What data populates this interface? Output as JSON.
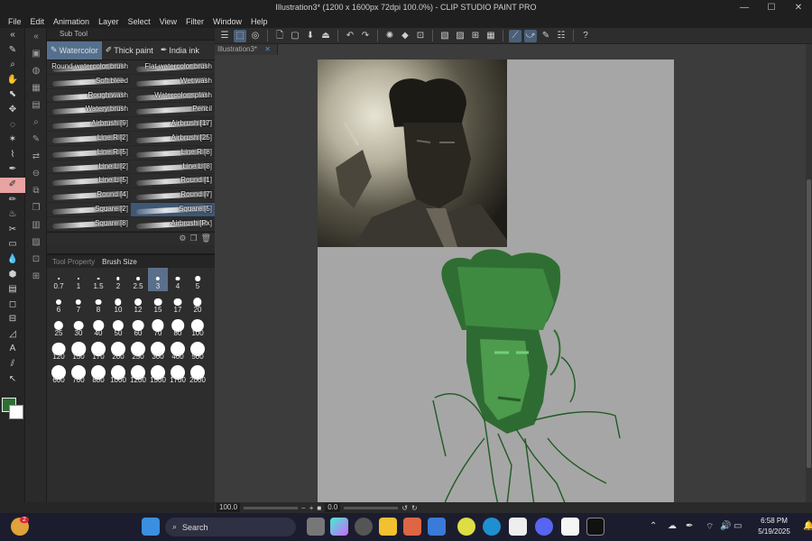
{
  "window": {
    "title": "Illustration3* (1200 x 1600px 72dpi 100.0%) - CLIP STUDIO PAINT PRO",
    "minimize": "—",
    "maximize": "☐",
    "close": "✕"
  },
  "menu": [
    "File",
    "Edit",
    "Animation",
    "Layer",
    "Select",
    "View",
    "Filter",
    "Window",
    "Help"
  ],
  "doc_tab": {
    "label": "Illustration3*",
    "close": "✕"
  },
  "sub_tool_panel": {
    "title": "Sub Tool",
    "tabs": [
      {
        "label": "Watercolor",
        "active": true
      },
      {
        "label": "Thick paint",
        "active": false
      },
      {
        "label": "India ink",
        "active": false
      }
    ],
    "brushes": [
      "Round watercolor brush",
      "Flat watercolor brush",
      "Soft bleed",
      "Wet wash",
      "Rough wash",
      "Watercolor splash",
      "Watery brush",
      "Pencil",
      "Airbrush [9]",
      "Airbrush [17]",
      "Line R [2]",
      "Airbrush [25]",
      "Line R [5]",
      "Line R [8]",
      "Line L [2]",
      "Line L [8]",
      "Line L [5]",
      "Round [1]",
      "Round [4]",
      "Round [7]",
      "Square [2]",
      "Square [5]",
      "Square [8]",
      "Airbrush [Px]"
    ],
    "selected_brush": "Square [5]"
  },
  "brush_size_panel": {
    "tabs": [
      {
        "label": "Tool Property",
        "active": false
      },
      {
        "label": "Brush Size",
        "active": true
      }
    ],
    "sizes": [
      "0.7",
      "1",
      "1.5",
      "2",
      "2.5",
      "3",
      "4",
      "5",
      "6",
      "7",
      "8",
      "10",
      "12",
      "15",
      "17",
      "20",
      "25",
      "30",
      "40",
      "50",
      "60",
      "70",
      "80",
      "100",
      "120",
      "150",
      "170",
      "200",
      "250",
      "300",
      "400",
      "500",
      "600",
      "700",
      "800",
      "1000",
      "1200",
      "1500",
      "1700",
      "2000"
    ],
    "selected": "3"
  },
  "colors": {
    "main": "#2f6e32",
    "sub": "#ffffff",
    "accent": "#55708e",
    "active_tool": "#e8a3a3"
  },
  "status": {
    "zoom": "100.0",
    "rotation": "0.0"
  },
  "taskbar": {
    "search_placeholder": "Search",
    "time": "6:58 PM",
    "date": "5/19/2025",
    "notification_count": "2"
  }
}
